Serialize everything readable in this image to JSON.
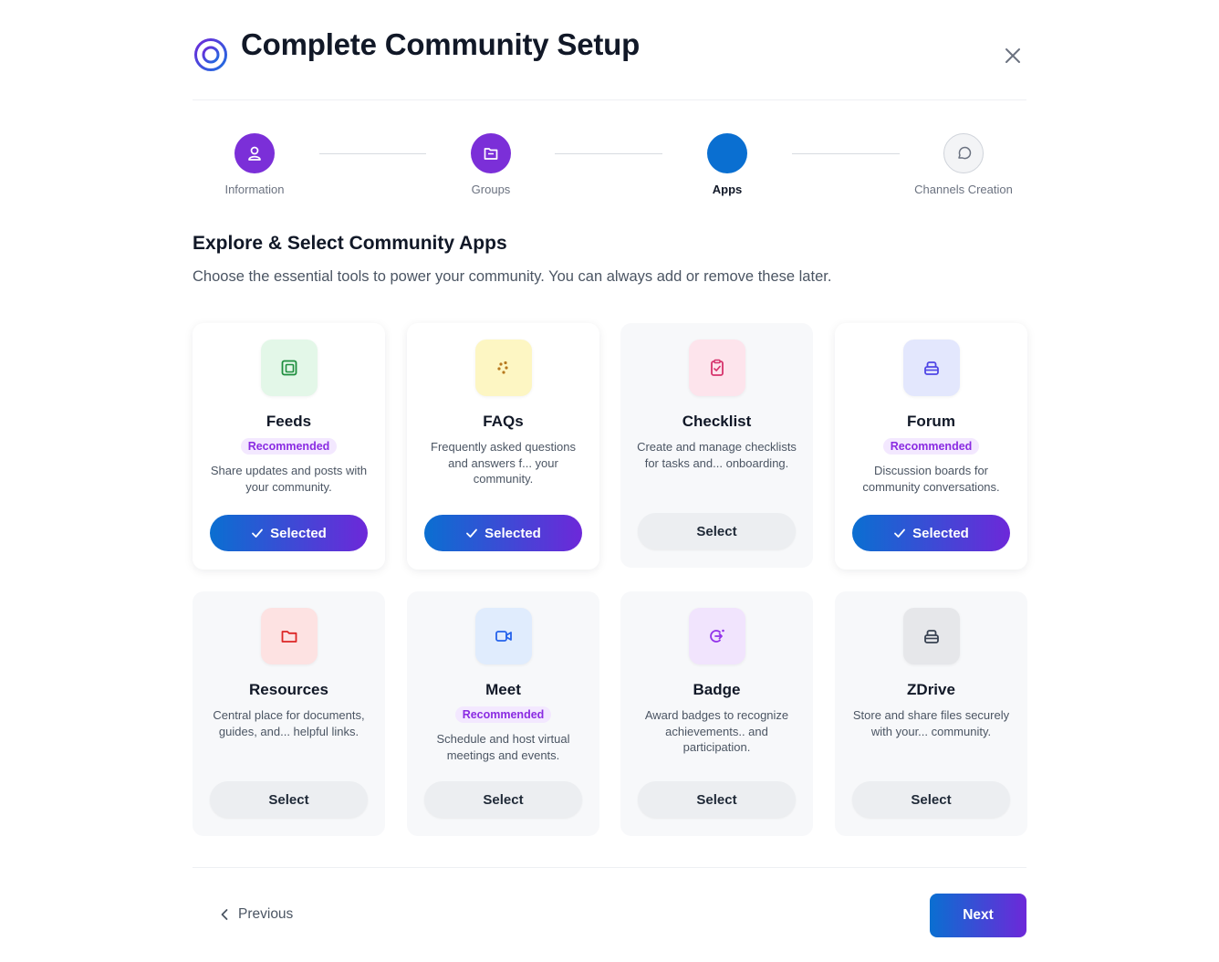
{
  "modal": {
    "title": "Complete Community Setup",
    "logo_icon": "target-ring-icon",
    "close_icon": "close-icon"
  },
  "stepper": {
    "steps": [
      {
        "label": "Information",
        "status": "done",
        "icon": "user-icon"
      },
      {
        "label": "Groups",
        "status": "done",
        "icon": "folder-icon"
      },
      {
        "label": "Apps",
        "status": "active",
        "icon": ""
      },
      {
        "label": "Channels Creation",
        "status": "todo",
        "icon": "chat-bubble-icon"
      }
    ]
  },
  "section": {
    "title": "Explore & Select Community Apps",
    "subtitle": "Choose the essential tools to power your community. You can always add or remove these later."
  },
  "apps": [
    {
      "name": "Feeds",
      "badge": "Recommended",
      "description": "Share updates and posts with your community.",
      "button": "Selected",
      "selected": true,
      "icon": "feed-icon",
      "icon_bg": "#e3f7e8",
      "icon_color": "#1e8e3e"
    },
    {
      "name": "FAQs",
      "badge": "",
      "description": "Frequently asked questions and answers f... your community.",
      "button": "Selected",
      "selected": true,
      "icon": "faq-icon",
      "icon_bg": "#fdf6c3",
      "icon_color": "#b7791f"
    },
    {
      "name": "Checklist",
      "badge": "",
      "description": "Create and manage checklists for tasks and... onboarding.",
      "button": "Select",
      "selected": false,
      "icon": "clipboard-check-icon",
      "icon_bg": "#fde4ec",
      "icon_color": "#d6336c"
    },
    {
      "name": "Forum",
      "badge": "Recommended",
      "description": "Discussion boards for community conversations.",
      "button": "Selected",
      "selected": true,
      "icon": "forum-icon",
      "icon_bg": "#e3e7fd",
      "icon_color": "#4f46e5"
    },
    {
      "name": "Resources",
      "badge": "",
      "description": "Central place for documents, guides, and... helpful links.",
      "button": "Select",
      "selected": false,
      "icon": "folder-icon",
      "icon_bg": "#fde2e2",
      "icon_color": "#dc2626"
    },
    {
      "name": "Meet",
      "badge": "Recommended",
      "description": "Schedule and host virtual meetings and events.",
      "button": "Select",
      "selected": false,
      "icon": "video-camera-icon",
      "icon_bg": "#e0ecfd",
      "icon_color": "#2563eb"
    },
    {
      "name": "Badge",
      "badge": "",
      "description": "Award badges to recognize achievements.. and participation.",
      "button": "Select",
      "selected": false,
      "icon": "badge-icon",
      "icon_bg": "#f1e4fd",
      "icon_color": "#9333ea"
    },
    {
      "name": "ZDrive",
      "badge": "",
      "description": "Store and share files securely with your... community.",
      "button": "Select",
      "selected": false,
      "icon": "drive-icon",
      "icon_bg": "#e6e7ea",
      "icon_color": "#374151"
    }
  ],
  "footer": {
    "previous": "Previous",
    "next": "Next"
  }
}
